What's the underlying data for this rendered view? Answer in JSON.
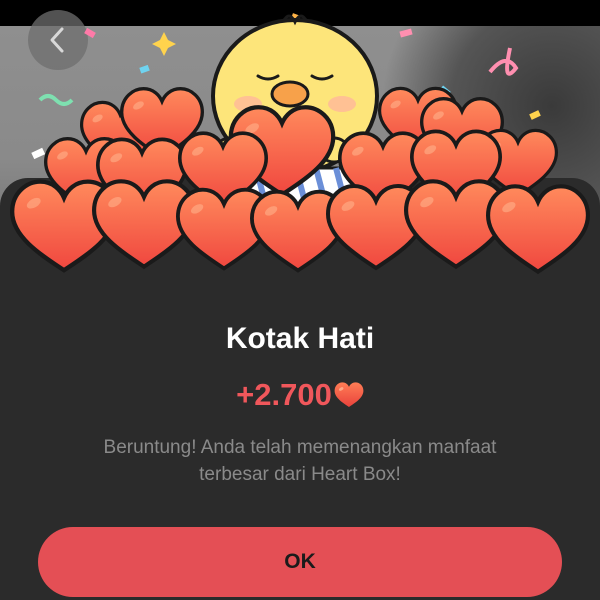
{
  "dialog": {
    "title": "Kotak Hati",
    "reward_amount": "+2.700",
    "message_line1": "Beruntung! Anda telah memenangkan manfaat",
    "message_line2": "terbesar dari Heart Box!",
    "ok_label": "OK"
  },
  "icons": {
    "back": "chevron-left-icon",
    "reward": "heart-icon",
    "illustration": "chick-with-hearts"
  },
  "colors": {
    "accent": "#e44f55",
    "reward_text": "#f0575b",
    "sheet_background": "#2b2b2b",
    "heart_fill": "#f56a45",
    "chick_yellow": "#fde57a"
  }
}
